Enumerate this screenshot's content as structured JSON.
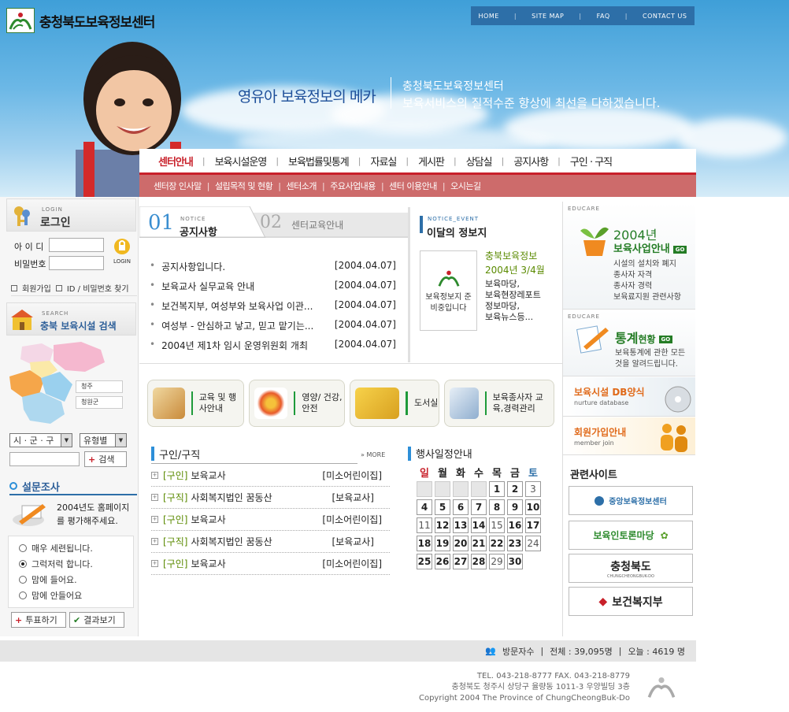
{
  "header": {
    "site_name": "충청북도보육정보센터",
    "top_nav": [
      "HOME",
      "SITE MAP",
      "FAQ",
      "CONTACT US"
    ],
    "slogan_main": "영유아 보육정보의 메카",
    "slogan_org": "충청북도보육정보센터",
    "slogan_desc": "보육서비스의 질적수준 향상에 최선을 다하겠습니다."
  },
  "main_nav": [
    "센터안내",
    "보육시설운영",
    "보육법률및통계",
    "자료실",
    "게시판",
    "상담실",
    "공지사항",
    "구인 · 구직"
  ],
  "sub_nav": [
    "센터장 인사말",
    "설립목적 및 현황",
    "센터소개",
    "주요사업내용",
    "센터 이용안내",
    "오시는길"
  ],
  "login": {
    "caption": "LOGIN",
    "title": "로그인",
    "id_label": "아 이 디",
    "pw_label": "비밀번호",
    "login_btn": "LOGIN",
    "join": "회원가입",
    "find": "ID / 비밀번호 찾기"
  },
  "search": {
    "caption": "SEARCH",
    "title": "충북 보육시설 검색",
    "map_labels": [
      "청주",
      "청원군"
    ],
    "region_select": "시 · 군 · 구",
    "type_select": "유형별",
    "search_btn": "검색"
  },
  "survey": {
    "title": "설문조사",
    "question": "2004년도 홈페이지를 평가해주세요.",
    "options": [
      "매우 세련됩니다.",
      "그럭저럭 합니다.",
      "맘에 들어요.",
      "맘에 안들어요"
    ],
    "selected_index": 1,
    "vote_btn": "투표하기",
    "result_btn": "결과보기"
  },
  "notice": {
    "tab1_num": "01",
    "tab1_caption": "NOTICE",
    "tab1_label": "공지사항",
    "tab2_num": "02",
    "tab2_label": "센터교육안내",
    "items": [
      {
        "title": "공지사항입니다.",
        "date": "[2004.04.07]"
      },
      {
        "title": "보육교사 실무교육 안내",
        "date": "[2004.04.07]"
      },
      {
        "title": "보건복지부, 여성부와 보육사업 이관...",
        "date": "[2004.04.07]"
      },
      {
        "title": "여성부 - 안심하고 낳고, 믿고 맡기는...",
        "date": "[2004.04.07]"
      },
      {
        "title": "2004년 제1차 임시 운영위원회 개최",
        "date": "[2004.04.07]"
      }
    ]
  },
  "event": {
    "caption": "NOTICE_EVENT",
    "title": "이달의 정보지",
    "thumb_text": "보육정보지 준비중입니다",
    "mag_title": "충북보육정보",
    "mag_issue": "2004년 3/4월",
    "mag_items": [
      "보육마당,",
      "보육현장레포트",
      "정보마당,",
      "보육뉴스등..."
    ]
  },
  "categories": [
    {
      "label": "교육 및 행사안내"
    },
    {
      "label": "영양/ 건강,안전"
    },
    {
      "label": "도서실"
    },
    {
      "label": "보육종사자 교육,경력관리"
    }
  ],
  "jobs": {
    "title": "구인/구직",
    "more": "MORE",
    "items": [
      {
        "type": "[구인]",
        "title": "보육교사",
        "right": "[미소어린이집]"
      },
      {
        "type": "[구직]",
        "title": "사회복지법인 꿈동산",
        "right": "[보육교사]"
      },
      {
        "type": "[구인]",
        "title": "보육교사",
        "right": "[미소어린이집]"
      },
      {
        "type": "[구직]",
        "title": "사회복지법인 꿈동산",
        "right": "[보육교사]"
      },
      {
        "type": "[구인]",
        "title": "보육교사",
        "right": "[미소어린이집]"
      }
    ]
  },
  "calendar": {
    "title": "행사일정안내",
    "weekdays": [
      "일",
      "월",
      "화",
      "수",
      "목",
      "금",
      "토"
    ],
    "blank_count": 4,
    "days": [
      "1",
      "2",
      "3",
      "4",
      "5",
      "6",
      "7",
      "8",
      "9",
      "10",
      "11",
      "12",
      "13",
      "14",
      "15",
      "16",
      "17",
      "18",
      "19",
      "20",
      "21",
      "22",
      "23",
      "24",
      "25",
      "26",
      "27",
      "28",
      "29",
      "30"
    ],
    "light_days": [
      "3",
      "11",
      "15",
      "24",
      "29"
    ]
  },
  "right": {
    "caption": "EDUCARE",
    "biz_year": "2004년",
    "biz_title": "보육사업안내",
    "biz_items": [
      "시설의 설치와 폐지",
      "종사자 자격",
      "종사자 경력",
      "보육료지원 관련사항"
    ],
    "stat_title_a": "통계",
    "stat_title_b": "현황",
    "stat_desc": "보육통계에 관한 모든 것을 알려드립니다.",
    "db_title": "보육시설 DB양식",
    "db_sub": "nurture database",
    "join_title": "회원가입안내",
    "join_sub": "member join",
    "go": "GO",
    "related_title": "관련사이트",
    "sites": [
      "중앙보육정보센터",
      "보육인토론마당",
      "충청북도",
      "보건복지부"
    ],
    "sites_sub": "CHUNGCHEONGBUK-DO"
  },
  "footer": {
    "visitors_label": "방문자수",
    "total": "전체 : 39,095명",
    "today": "오늘 : 4619 명",
    "tel": "TEL. 043-218-8777 FAX. 043-218-8779",
    "address": "충청북도 청주시 상당구 율량동 1011-3 우양빌딩 3층",
    "copyright": "Copyright 2004 The Province of ChungCheongBuk-Do"
  },
  "colors": {
    "accent_red": "#c8202a",
    "subnav": "#cd6b6b",
    "green": "#247c25",
    "blue": "#2d6fa8"
  }
}
